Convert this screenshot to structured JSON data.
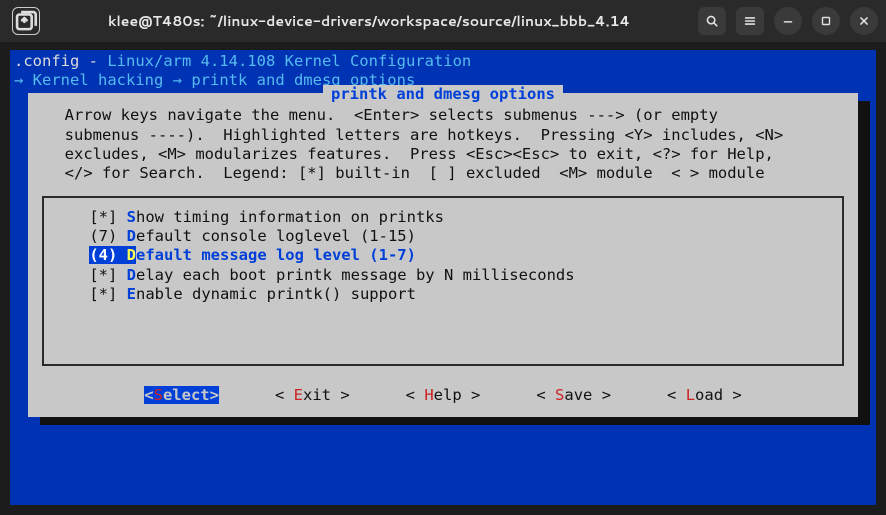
{
  "window": {
    "title": "klee@T480s: ~/linux-device-drivers/workspace/source/linux_bbb_4.14"
  },
  "config_header": {
    "file": ".config",
    "dash": " - ",
    "desc": "Linux/arm 4.14.108 Kernel Configuration"
  },
  "breadcrumb": {
    "arrow1": "→ ",
    "seg1": "Kernel hacking",
    "arrow2": " → ",
    "seg2": "printk and dmesg options",
    "trail": " "
  },
  "dialog": {
    "title": " printk and dmesg options ",
    "help_text": "  Arrow keys navigate the menu.  <Enter> selects submenus ---> (or empty\n  submenus ----).  Highlighted letters are hotkeys.  Pressing <Y> includes, <N>\n  excludes, <M> modularizes features.  Press <Esc><Esc> to exit, <?> for Help,\n  </> for Search.  Legend: [*] built-in  [ ] excluded  <M> module  < > module"
  },
  "menu": {
    "items": [
      {
        "prefix": "    [*] ",
        "hot": "S",
        "rest": "how timing information on printks"
      },
      {
        "prefix": "    (7) ",
        "hot": "D",
        "rest": "efault console loglevel (1-15)"
      },
      {
        "prefix": "    (4) ",
        "hot": "D",
        "rest": "efault message log level (1-7)",
        "selected": true,
        "sel_prefix": "(4) ",
        "indent": "    "
      },
      {
        "prefix": "    [*] ",
        "hot": "D",
        "rest": "elay each boot printk message by N milliseconds"
      },
      {
        "prefix": "    [*] ",
        "hot": "E",
        "rest": "nable dynamic printk() support"
      }
    ]
  },
  "buttons": {
    "select": {
      "open": "<",
      "hot": "S",
      "rest": "elect",
      "close": ">"
    },
    "exit": {
      "open": "< ",
      "hot": "E",
      "rest": "xit",
      "close": " >"
    },
    "help": {
      "open": "< ",
      "hot": "H",
      "rest": "elp",
      "close": " >"
    },
    "save": {
      "open": "< ",
      "hot": "S",
      "rest": "ave",
      "close": " >"
    },
    "load": {
      "open": "< ",
      "hot": "L",
      "rest": "oad",
      "close": " >"
    }
  }
}
